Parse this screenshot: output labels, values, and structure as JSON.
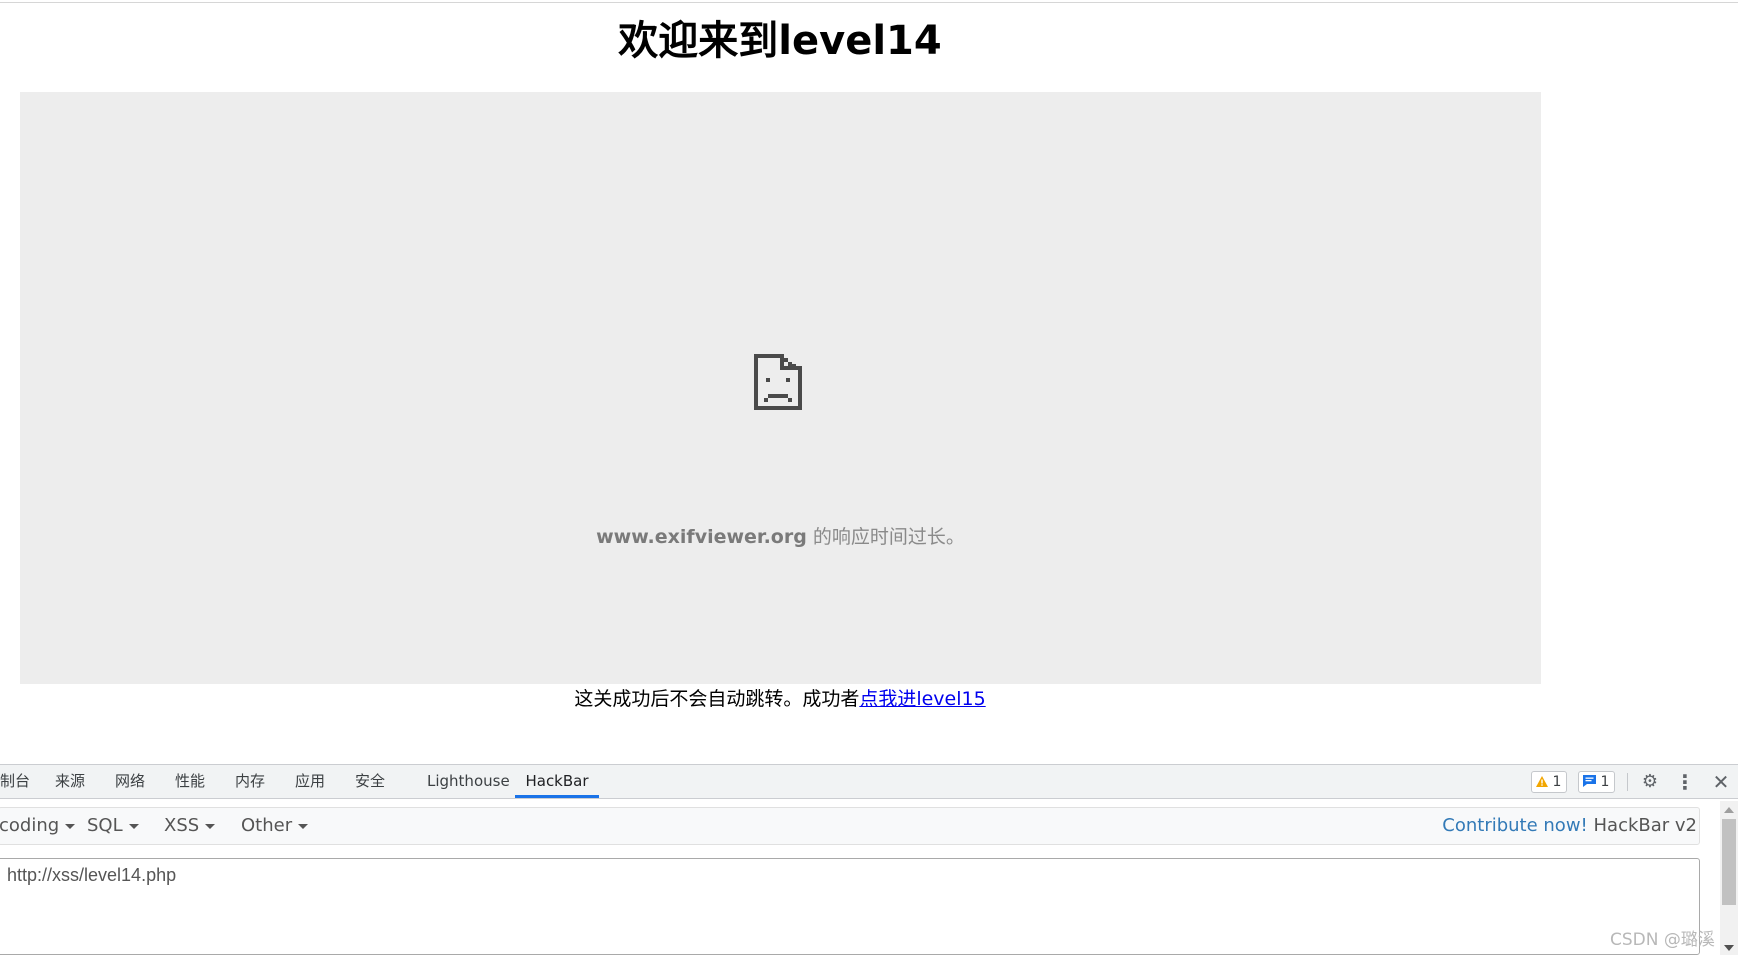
{
  "page": {
    "title": "欢迎来到level14",
    "iframe_error": {
      "host": "www.exifviewer.org",
      "message": " 的响应时间过长。"
    },
    "next": {
      "text": "这关成功后不会自动跳转。成功者",
      "link_label": "点我进level15"
    }
  },
  "devtools": {
    "tabs": [
      {
        "label": "制台",
        "active": false
      },
      {
        "label": "来源",
        "active": false
      },
      {
        "label": "网络",
        "active": false
      },
      {
        "label": "性能",
        "active": false
      },
      {
        "label": "内存",
        "active": false
      },
      {
        "label": "应用",
        "active": false
      },
      {
        "label": "安全",
        "active": false
      },
      {
        "label": "Lighthouse",
        "active": false
      },
      {
        "label": "HackBar",
        "active": true
      }
    ],
    "warnings_count": "1",
    "messages_count": "1",
    "icons": {
      "warning": "warning-icon",
      "message": "message-icon",
      "settings": "gear-icon",
      "more": "more-vertical-icon",
      "close": "close-icon"
    },
    "accent": "#1a73e8"
  },
  "hackbar": {
    "menus": [
      "coding",
      "SQL",
      "XSS",
      "Other"
    ],
    "contribute_label": "Contribute now!",
    "version_label": "HackBar v2",
    "url": "http://xss/level14.php"
  },
  "watermark": "CSDN @璐溪"
}
